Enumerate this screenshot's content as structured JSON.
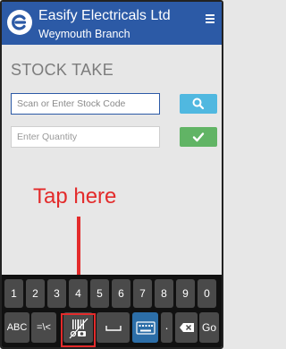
{
  "header": {
    "company": "Easify Electricals Ltd",
    "branch": "Weymouth Branch",
    "colors": {
      "brand": "#2c5aa6"
    }
  },
  "page": {
    "title": "STOCK TAKE"
  },
  "form": {
    "stock_code_placeholder": "Scan or Enter Stock Code",
    "quantity_placeholder": "Enter Quantity",
    "search_button_color": "#50b8e0",
    "confirm_button_color": "#61b465"
  },
  "annotation": {
    "text": "Tap here",
    "color": "#e32b2b"
  },
  "keyboard": {
    "number_row": [
      "1",
      "2",
      "3",
      "4",
      "5",
      "6",
      "7",
      "8",
      "9",
      "0"
    ],
    "keys": {
      "abc": "ABC",
      "symbols": "=\\<",
      "dot": "·",
      "go": "Go"
    },
    "icons": [
      "barcode-scanner-icon",
      "space-icon",
      "keyboard-icon",
      "backspace-icon"
    ]
  }
}
